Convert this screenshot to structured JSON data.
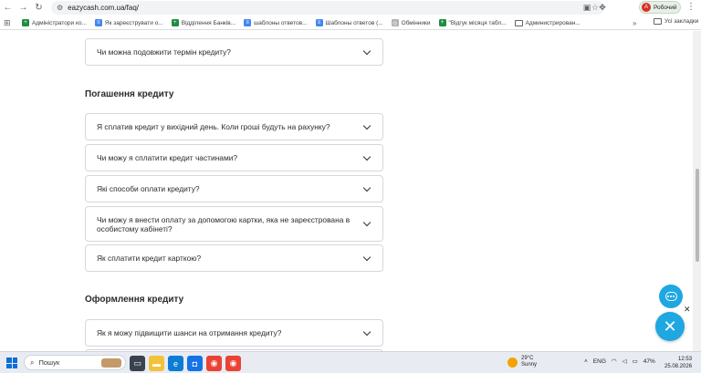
{
  "browser": {
    "url": "eazycash.com.ua/faq/",
    "profile_label": "Робочий",
    "profile_initial": "А"
  },
  "bookmarks": {
    "items": [
      {
        "label": "Адміністратори ко...",
        "color": "#1e8e3e",
        "icon": "sheets-icon"
      },
      {
        "label": "Як зареєструвати о...",
        "color": "#4285f4",
        "icon": "docs-icon"
      },
      {
        "label": "Відділення Банків...",
        "color": "#1e8e3e",
        "icon": "sheets-icon"
      },
      {
        "label": "шаблоны ответов...",
        "color": "#4285f4",
        "icon": "docs-icon"
      },
      {
        "label": "Шаблоны ответов (...",
        "color": "#4285f4",
        "icon": "docs-icon"
      },
      {
        "label": "Обмінники",
        "color": "#b0b0b0",
        "icon": "globe-icon"
      },
      {
        "label": "\"Відгук місяця табл...",
        "color": "#1e8e3e",
        "icon": "sheets-icon"
      },
      {
        "label": "Администрирован...",
        "color": "#ffffff",
        "icon": "folder-icon"
      }
    ],
    "more": "»",
    "all_label": "Усі закладки"
  },
  "faq": {
    "top_item": "Чи можна подовжити термін кредиту?",
    "section_repayment": "Погашення кредиту",
    "repayment_items": [
      "Я сплатив кредит у вихідний день. Коли гроші будуть на рахунку?",
      "Чи можу я сплатити кредит частинами?",
      "Які способи оплати кредиту?",
      "Чи можу я внести оплату за допомогою картки, яка не зареєстрована в особистому кабінеті?",
      "Як сплатити кредит карткою?"
    ],
    "section_registration": "Оформлення кредиту",
    "registration_items": [
      "Як я можу підвищити шанси на отримання кредиту?"
    ]
  },
  "widgets": {
    "close_small": "✕",
    "close_big": "✕",
    "accent_color": "#1ea7e1"
  },
  "taskbar": {
    "search_placeholder": "Пошук",
    "weather_temp": "29°C",
    "weather_desc": "Sunny",
    "lang": "ENG",
    "battery": "47%",
    "time": "12:53",
    "date": "25.08.2026"
  }
}
